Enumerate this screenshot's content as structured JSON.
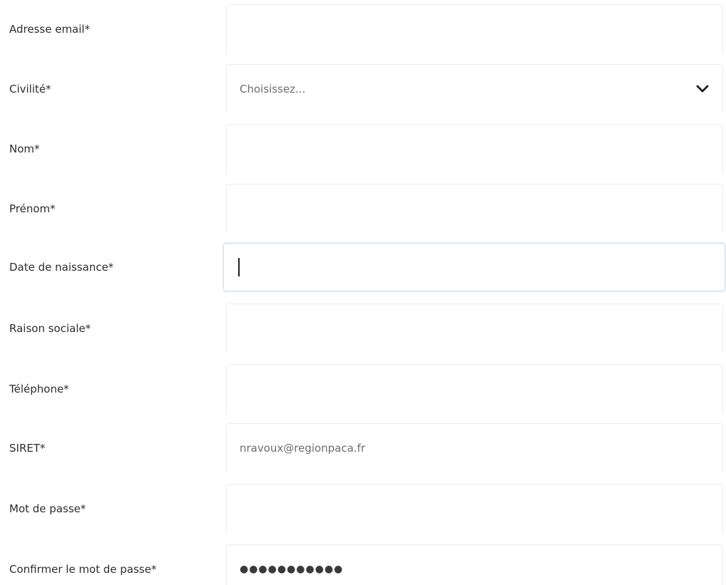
{
  "form": {
    "fields": [
      {
        "key": "email",
        "label": "Adresse email*",
        "value": ""
      },
      {
        "key": "civilite",
        "label": "Civilité*",
        "selected": "Choisissez..."
      },
      {
        "key": "nom",
        "label": "Nom*",
        "value": ""
      },
      {
        "key": "prenom",
        "label": "Prénom*",
        "value": ""
      },
      {
        "key": "date",
        "label": "Date de naissance*",
        "value": ""
      },
      {
        "key": "raison",
        "label": "Raison sociale*",
        "value": ""
      },
      {
        "key": "telephone",
        "label": "Téléphone*",
        "value": ""
      },
      {
        "key": "siret",
        "label": "SIRET*",
        "value": "nravoux@regionpaca.fr"
      },
      {
        "key": "password",
        "label": "Mot de passe*",
        "value": ""
      },
      {
        "key": "confirm",
        "label": "Confirmer le mot de passe*",
        "value": "●●●●●●●●●●●"
      }
    ]
  },
  "icons": {
    "select_chevron": "chevron-down-icon"
  },
  "colors": {
    "focus_border": "#cfe0f2",
    "field_border": "#ececec"
  }
}
